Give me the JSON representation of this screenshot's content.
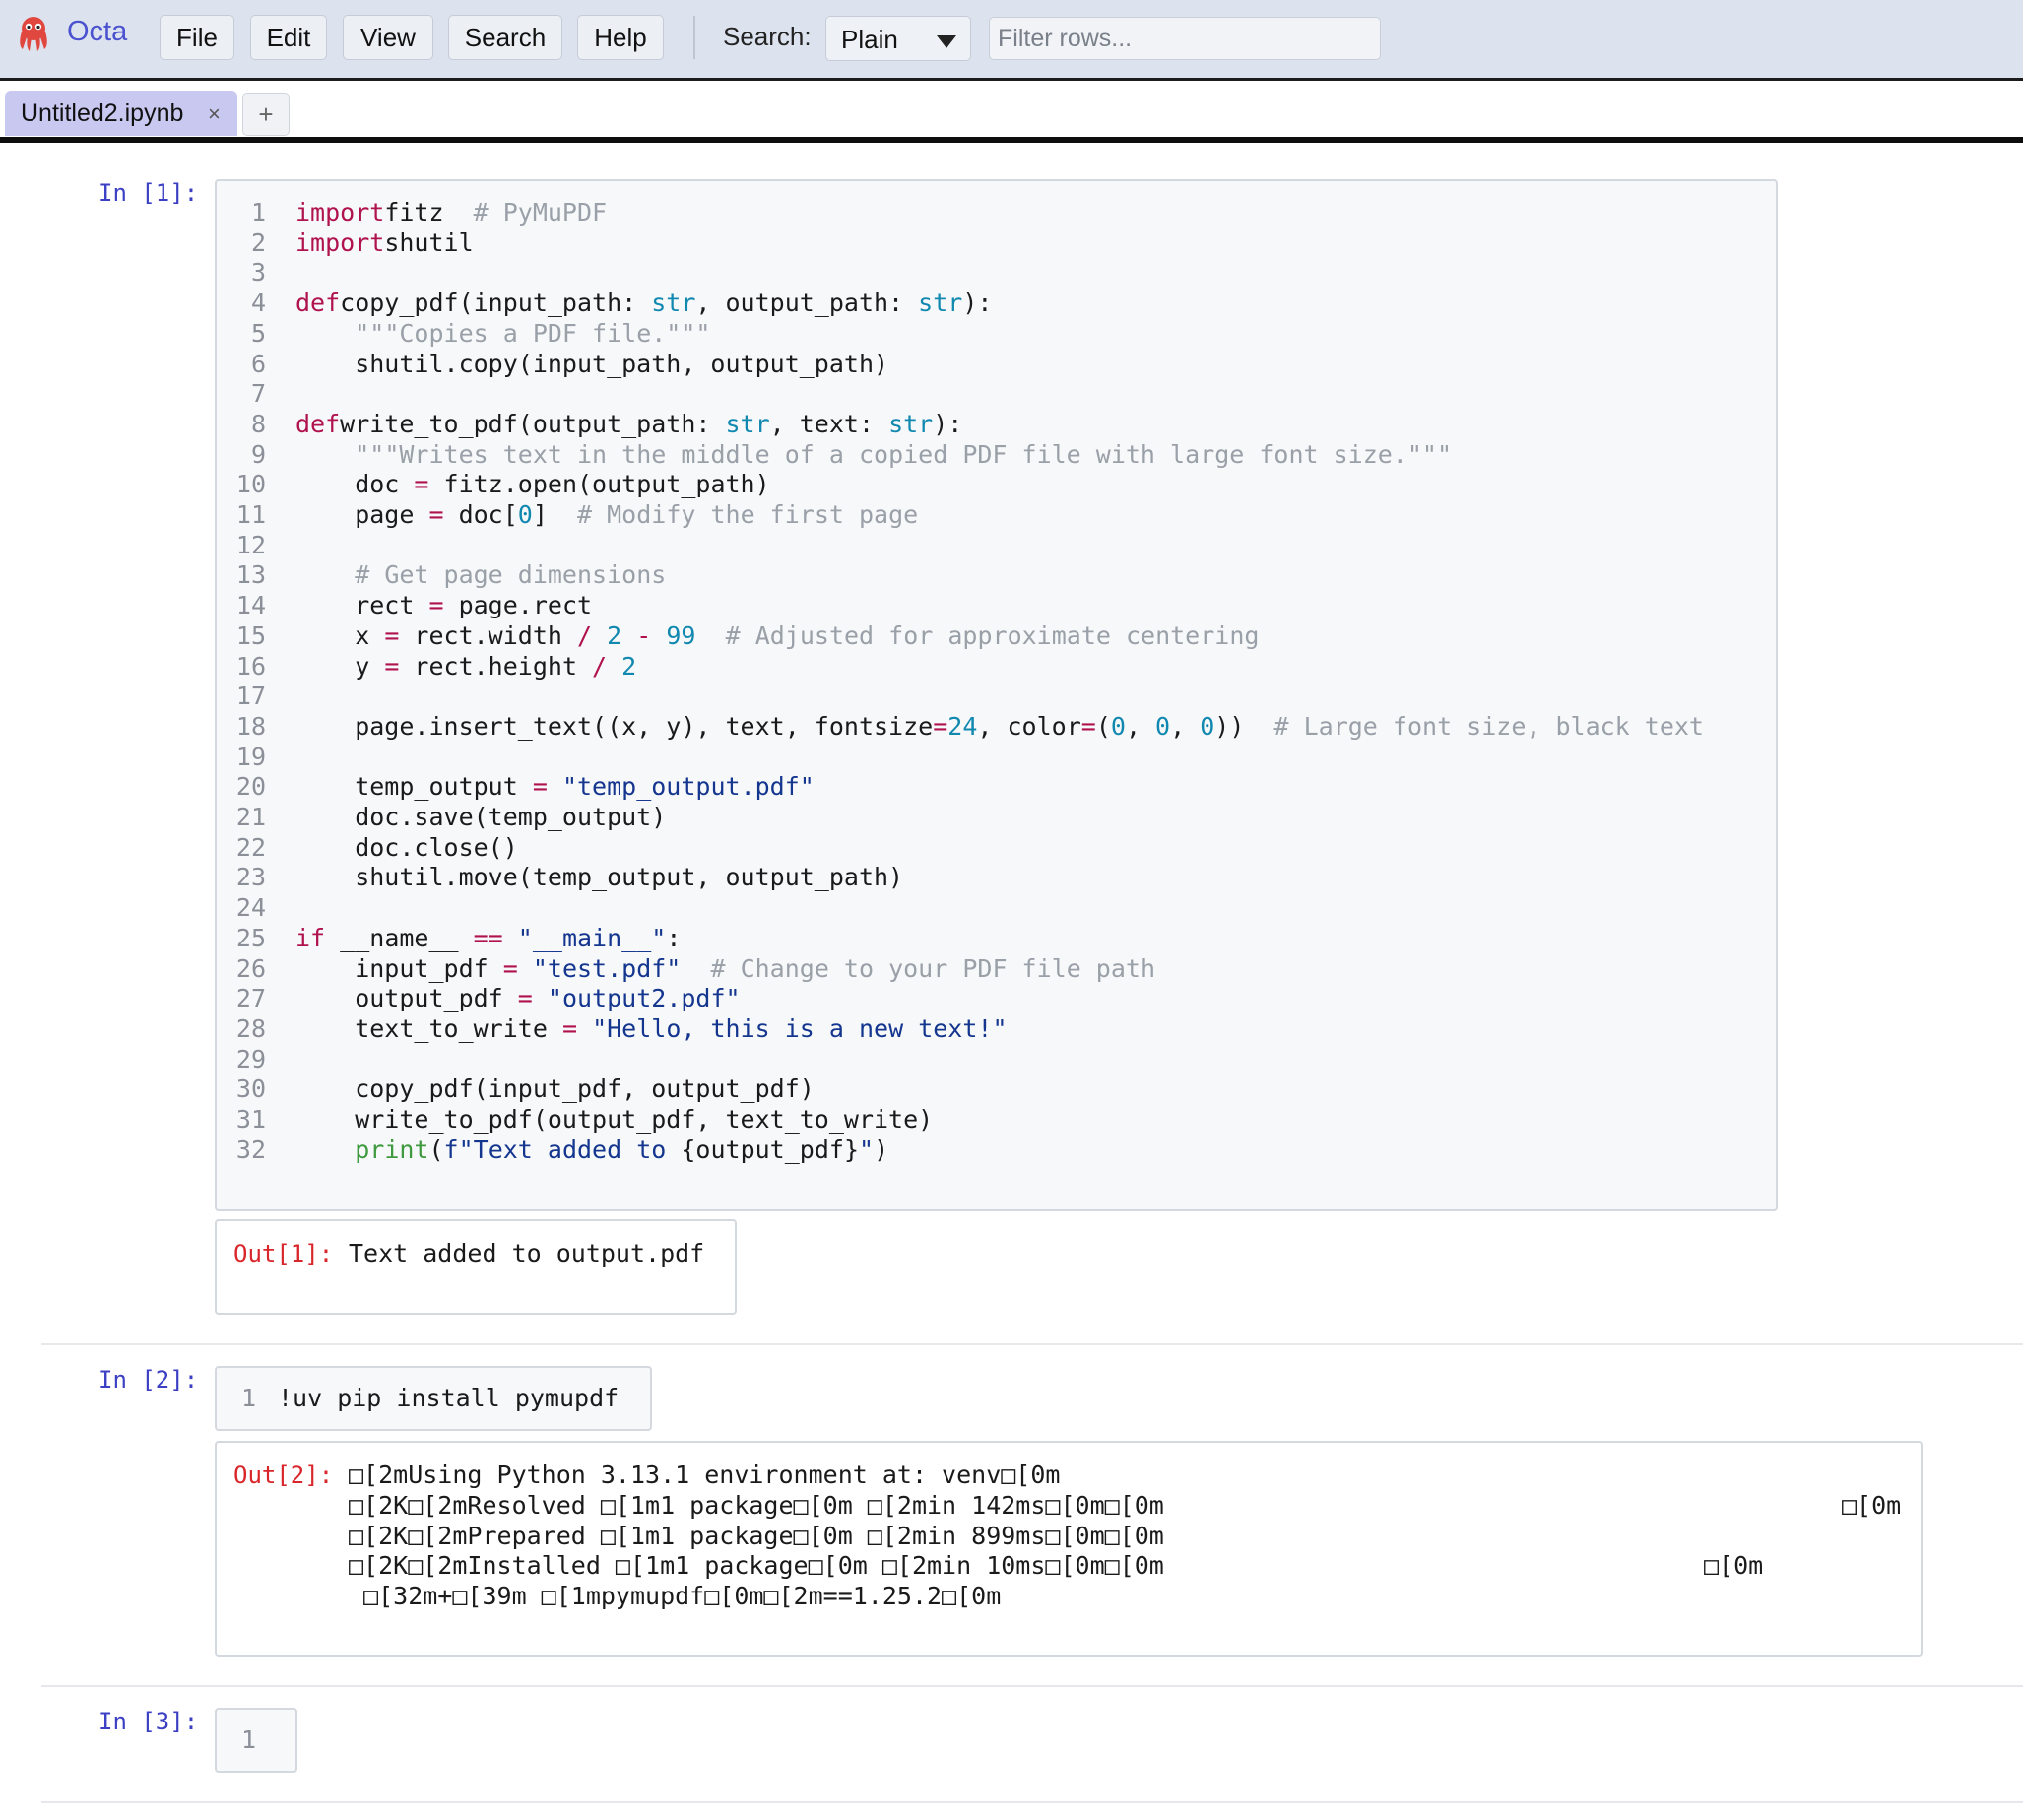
{
  "app": {
    "name": "Octa",
    "menu": [
      "File",
      "Edit",
      "View",
      "Search",
      "Help"
    ],
    "search_label": "Search:",
    "search_mode": "Plain",
    "filter_placeholder": "Filter rows..."
  },
  "tabs": [
    {
      "label": "Untitled2.ipynb",
      "close": "×"
    }
  ],
  "new_tab_label": "+",
  "cells": [
    {
      "in_prompt": "In [1]:",
      "code": [
        [
          [
            "kw",
            "import"
          ],
          [
            "",
            "fitz  "
          ],
          [
            "cm",
            "# PyMuPDF"
          ]
        ],
        [
          [
            "kw",
            "import"
          ],
          [
            "",
            "shutil"
          ]
        ],
        [],
        [
          [
            "kw",
            "def"
          ],
          [
            "",
            "copy_pdf(input_path: "
          ],
          [
            "bi",
            "str"
          ],
          [
            "",
            ", output_path: "
          ],
          [
            "bi",
            "str"
          ],
          [
            "",
            "):"
          ]
        ],
        [
          [
            "",
            "    "
          ],
          [
            "cm",
            "\"\"\"Copies a PDF file.\"\"\""
          ]
        ],
        [
          [
            "",
            "    shutil.copy(input_path, output_path)"
          ]
        ],
        [],
        [
          [
            "kw",
            "def"
          ],
          [
            "",
            "write_to_pdf(output_path: "
          ],
          [
            "bi",
            "str"
          ],
          [
            "",
            ", text: "
          ],
          [
            "bi",
            "str"
          ],
          [
            "",
            "):"
          ]
        ],
        [
          [
            "",
            "    "
          ],
          [
            "cm",
            "\"\"\"Writes text in the middle of a copied PDF file with large font size.\"\"\""
          ]
        ],
        [
          [
            "",
            "    doc "
          ],
          [
            "op",
            "="
          ],
          [
            "",
            " fitz.open(output_path)"
          ]
        ],
        [
          [
            "",
            "    page "
          ],
          [
            "op",
            "="
          ],
          [
            "",
            " doc["
          ],
          [
            "nm",
            "0"
          ],
          [
            "",
            "]  "
          ],
          [
            "cm",
            "# Modify the first page"
          ]
        ],
        [],
        [
          [
            "",
            "    "
          ],
          [
            "cm",
            "# Get page dimensions"
          ]
        ],
        [
          [
            "",
            "    rect "
          ],
          [
            "op",
            "="
          ],
          [
            "",
            " page.rect"
          ]
        ],
        [
          [
            "",
            "    x "
          ],
          [
            "op",
            "="
          ],
          [
            "",
            " rect.width "
          ],
          [
            "op",
            "/"
          ],
          [
            "",
            " "
          ],
          [
            "nm",
            "2"
          ],
          [
            "",
            " "
          ],
          [
            "op",
            "-"
          ],
          [
            "",
            " "
          ],
          [
            "nm",
            "99"
          ],
          [
            "",
            "  "
          ],
          [
            "cm",
            "# Adjusted for approximate centering"
          ]
        ],
        [
          [
            "",
            "    y "
          ],
          [
            "op",
            "="
          ],
          [
            "",
            " rect.height "
          ],
          [
            "op",
            "/"
          ],
          [
            "",
            " "
          ],
          [
            "nm",
            "2"
          ]
        ],
        [],
        [
          [
            "",
            "    page.insert_text((x, y), text, fontsize"
          ],
          [
            "op",
            "="
          ],
          [
            "nm",
            "24"
          ],
          [
            "",
            ", color"
          ],
          [
            "op",
            "="
          ],
          [
            "",
            "("
          ],
          [
            "nm",
            "0"
          ],
          [
            "",
            ", "
          ],
          [
            "nm",
            "0"
          ],
          [
            "",
            ", "
          ],
          [
            "nm",
            "0"
          ],
          [
            "",
            "))  "
          ],
          [
            "cm",
            "# Large font size, black text"
          ]
        ],
        [],
        [
          [
            "",
            "    temp_output "
          ],
          [
            "op",
            "="
          ],
          [
            "",
            " "
          ],
          [
            "st",
            "\"temp_output.pdf\""
          ]
        ],
        [
          [
            "",
            "    doc.save(temp_output)"
          ]
        ],
        [
          [
            "",
            "    doc.close()"
          ]
        ],
        [
          [
            "",
            "    shutil.move(temp_output, output_path)"
          ]
        ],
        [],
        [
          [
            "kw",
            "if"
          ],
          [
            "",
            " __name__ "
          ],
          [
            "op",
            "=="
          ],
          [
            "",
            " "
          ],
          [
            "st",
            "\"__main__\""
          ],
          [
            "",
            ":"
          ]
        ],
        [
          [
            "",
            "    input_pdf "
          ],
          [
            "op",
            "="
          ],
          [
            "",
            " "
          ],
          [
            "st",
            "\"test.pdf\""
          ],
          [
            "",
            "  "
          ],
          [
            "cm",
            "# Change to your PDF file path"
          ]
        ],
        [
          [
            "",
            "    output_pdf "
          ],
          [
            "op",
            "="
          ],
          [
            "",
            " "
          ],
          [
            "st",
            "\"output2.pdf\""
          ]
        ],
        [
          [
            "",
            "    text_to_write "
          ],
          [
            "op",
            "="
          ],
          [
            "",
            " "
          ],
          [
            "st",
            "\"Hello, this is a new text!\""
          ]
        ],
        [],
        [
          [
            "",
            "    copy_pdf(input_pdf, output_pdf)"
          ]
        ],
        [
          [
            "",
            "    write_to_pdf(output_pdf, text_to_write)"
          ]
        ],
        [
          [
            "",
            "    "
          ],
          [
            "pr",
            "print"
          ],
          [
            "",
            "("
          ],
          [
            "st",
            "f\"Text added to "
          ],
          [
            "",
            "{output_pdf}"
          ],
          [
            "st",
            "\""
          ],
          [
            "",
            ")"
          ]
        ]
      ],
      "out_prompt": "Out[1]:",
      "output": [
        "Text added to output.pdf"
      ]
    },
    {
      "in_prompt": "In [2]:",
      "code": [
        [
          [
            "",
            "!uv pip install pymupdf"
          ]
        ]
      ],
      "out_prompt": "Out[2]:",
      "output": [
        "□[2mUsing Python 3.13.1 environment at: venv□[0m",
        "□[2K□[2mResolved □[1m1 package□[0m □[2min 142ms□[0m□[0m",
        "□[2K□[2mPrepared □[1m1 package□[0m □[2min 899ms□[0m□[0m",
        "□[2K□[2mInstalled □[1m1 package□[0m □[2min 10ms□[0m□[0m",
        " □[32m+□[39m □[1mpymupdf□[0m□[2m==1.25.2□[0m"
      ],
      "output_trailing": [
        "",
        "□[0m",
        "",
        "□[0m",
        ""
      ]
    },
    {
      "in_prompt": "In [3]:",
      "code": [
        []
      ]
    }
  ]
}
